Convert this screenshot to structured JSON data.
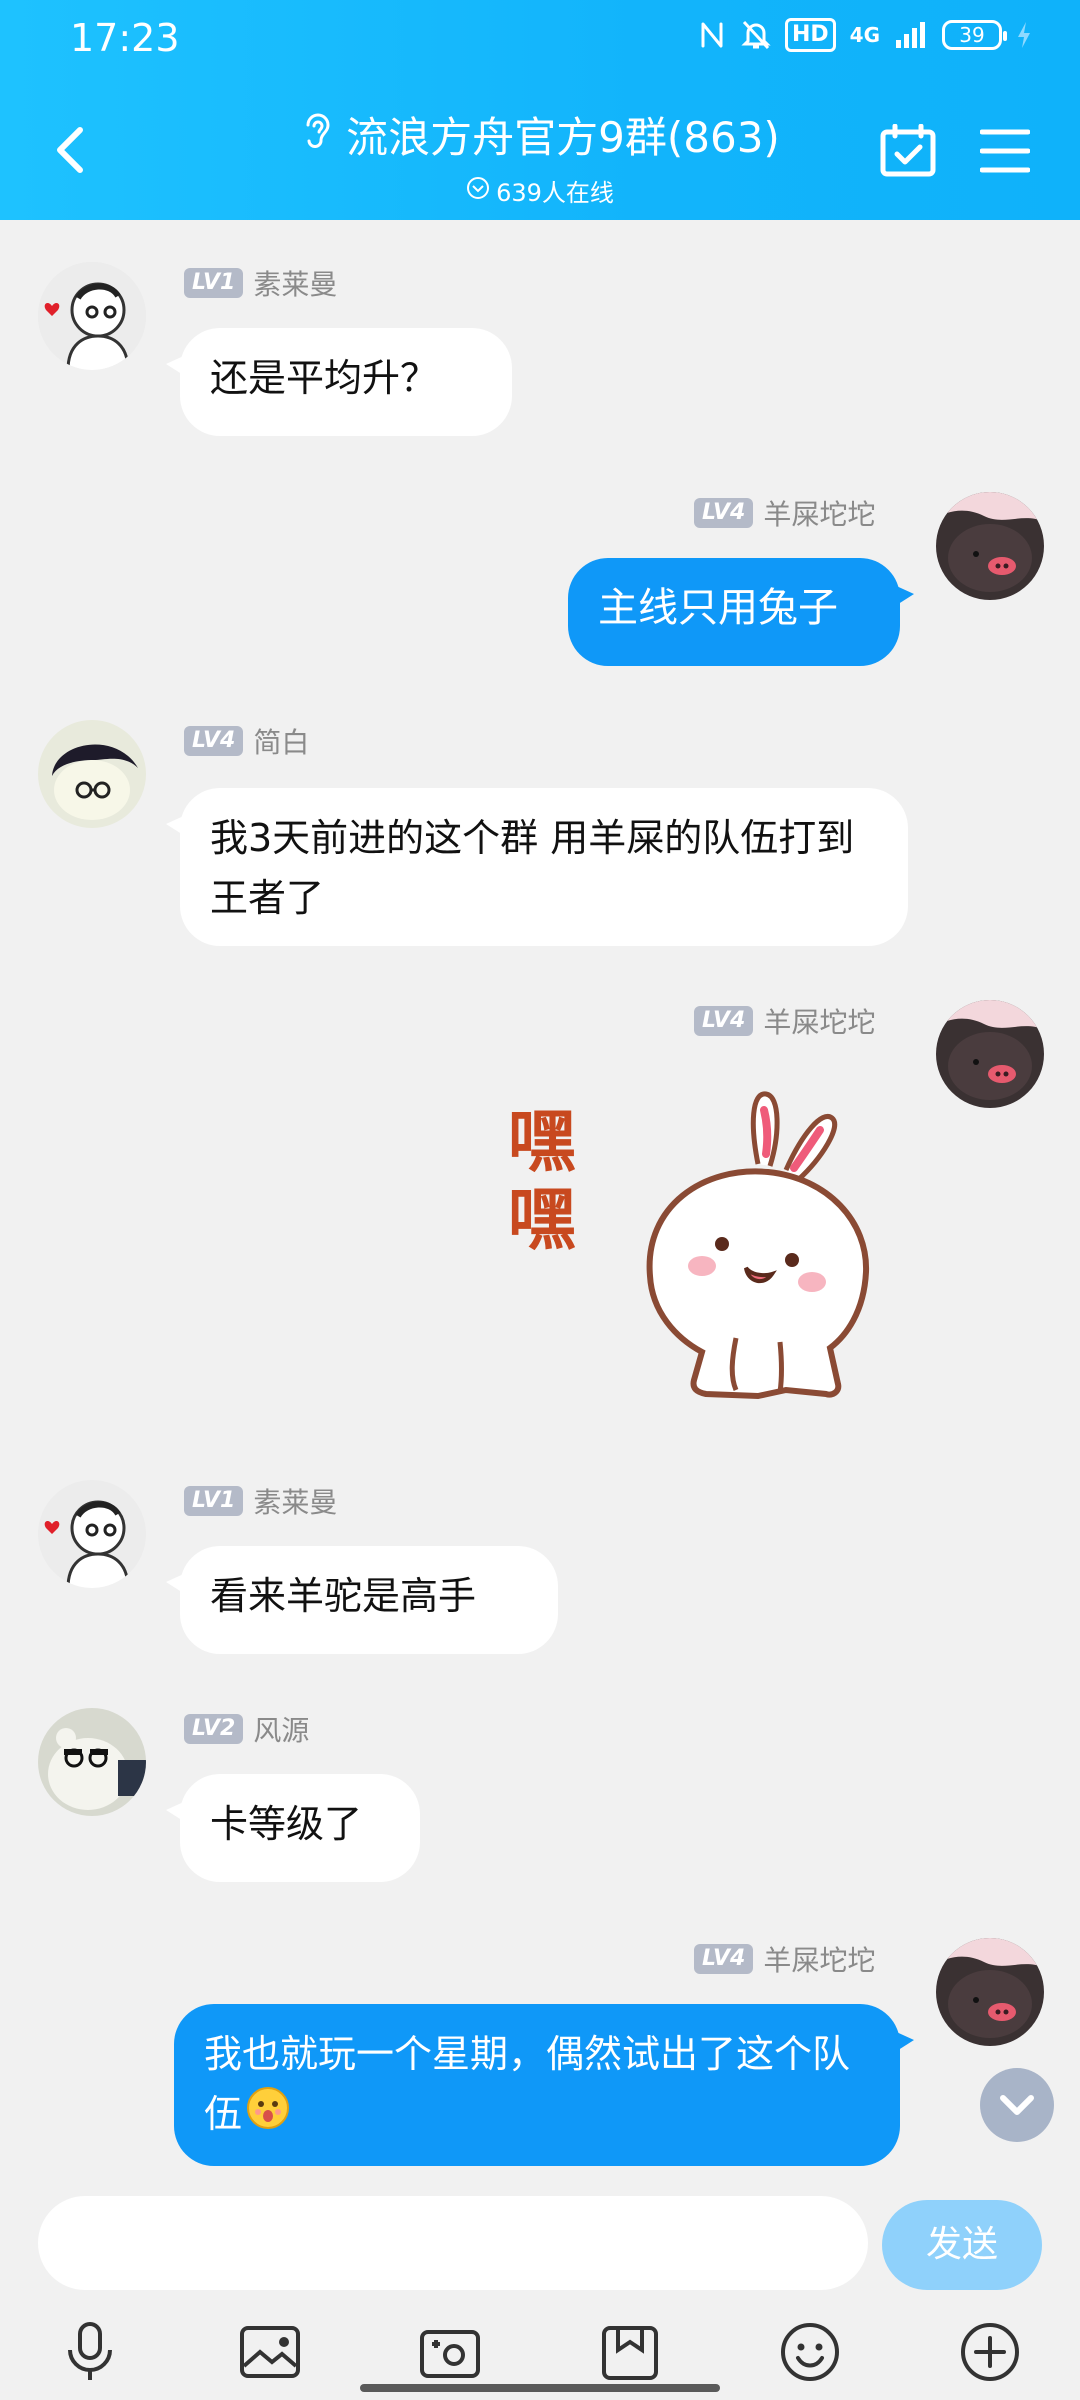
{
  "status_bar": {
    "time": "17:23",
    "hd": "HD",
    "network": "4G",
    "battery": "39"
  },
  "header": {
    "title": "流浪方舟官方9群(863)",
    "online": "639人在线"
  },
  "messages": [
    {
      "side": "left",
      "level": "LV1",
      "name": "素莱曼",
      "text": "还是平均升？"
    },
    {
      "side": "right",
      "level": "LV4",
      "name": "羊屎坨坨",
      "text": "主线只用兔子"
    },
    {
      "side": "left",
      "level": "LV4",
      "name": "简白",
      "text": "我3天前进的这个群  用羊屎的队伍打到王者了"
    },
    {
      "side": "right",
      "level": "LV4",
      "name": "羊屎坨坨",
      "sticker_text": "嘿嘿"
    },
    {
      "side": "left",
      "level": "LV1",
      "name": "素莱曼",
      "text": "看来羊驼是高手"
    },
    {
      "side": "left",
      "level": "LV2",
      "name": "风源",
      "text": "卡等级了"
    },
    {
      "side": "right",
      "level": "LV4",
      "name": "羊屎坨坨",
      "text": "我也就玩一个星期，偶然试出了这个队伍"
    }
  ],
  "input": {
    "placeholder": "",
    "send_label": "发送"
  },
  "toolbar": [
    "mic-icon",
    "image-icon",
    "camera-icon",
    "file-icon",
    "emoji-icon",
    "plus-icon"
  ]
}
